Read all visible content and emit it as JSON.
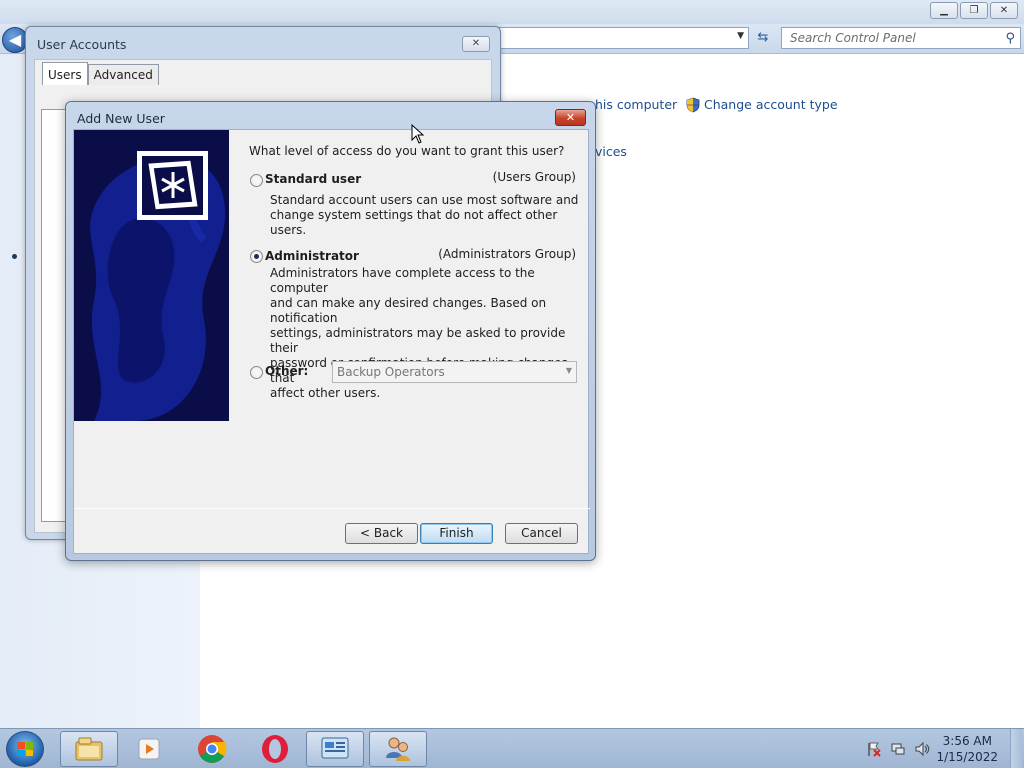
{
  "control_panel": {
    "search_placeholder": "Search Control Panel",
    "links": {
      "manage_computer_partial": "his computer",
      "change_account_type": "Change account type",
      "services_partial": "vices"
    }
  },
  "user_accounts": {
    "title": "User Accounts",
    "tabs": [
      {
        "label": "Users"
      },
      {
        "label": "Advanced"
      }
    ]
  },
  "add_new_user": {
    "title": "Add New User",
    "question": "What level of access do you want to grant this user?",
    "options": {
      "standard": {
        "label": "Standard user",
        "group": "(Users Group)",
        "description_lines": [
          "Standard account users can use most software and",
          "change system settings that do not affect other users."
        ],
        "checked": false
      },
      "administrator": {
        "label": "Administrator",
        "group": "(Administrators Group)",
        "description_lines": [
          "Administrators have complete access to the computer",
          "and can make any desired changes. Based on notification",
          "settings, administrators may be asked to provide their",
          "password or confirmation before making changes that",
          "affect other users."
        ],
        "checked": true
      },
      "other": {
        "label": "Other:",
        "dropdown_value": "Backup Operators",
        "checked": false
      }
    },
    "buttons": {
      "back": "< Back",
      "finish": "Finish",
      "cancel": "Cancel"
    }
  },
  "taskbar": {
    "items": [
      "windows-explorer",
      "media-player",
      "chrome",
      "opera",
      "control-panel",
      "user-accounts"
    ],
    "clock": {
      "time": "3:56 AM",
      "date": "1/15/2022"
    }
  },
  "colors": {
    "link": "#1e4e8f",
    "dialog_banner": "#0a0d48",
    "close_button": "#c8432b"
  }
}
